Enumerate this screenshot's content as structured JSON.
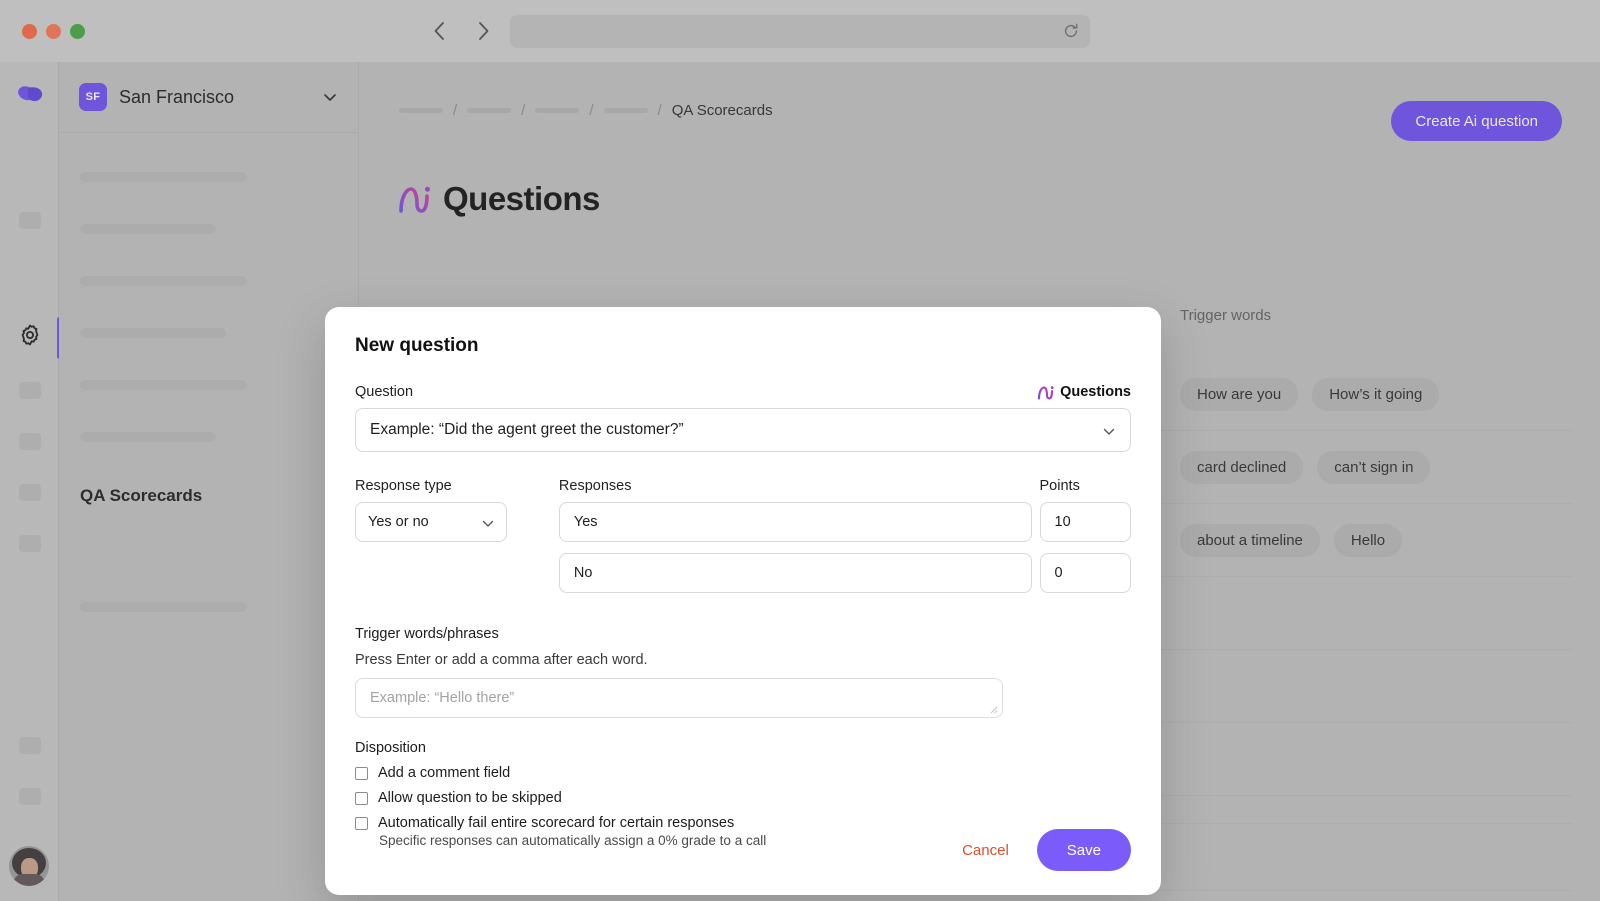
{
  "browser": {
    "traffic_lights": [
      "close",
      "minimize",
      "zoom"
    ],
    "back_label": "Back",
    "forward_label": "Forward",
    "url_value": "",
    "url_placeholder": "",
    "reload_label": "Reload"
  },
  "rail": {
    "logo_name": "app-logo",
    "active_item": "settings",
    "placeholder_count_top": 1,
    "placeholder_count_mid": 4,
    "placeholder_count_bottom": 2,
    "avatar_label": "User avatar"
  },
  "sidebar": {
    "org": {
      "initials": "SF",
      "name": "San Francisco",
      "chevron": "chevron-down-icon"
    },
    "section_title": "QA Scorecards"
  },
  "breadcrumb": {
    "placeholder_segments": 4,
    "separator": "/",
    "current": "QA Scorecards"
  },
  "header": {
    "create_button": "Create Ai question",
    "page_title": "Questions",
    "ai_mark": "ai-logo"
  },
  "panel": {
    "heading": "Trigger words",
    "rows": [
      {
        "chips": [
          "How are you",
          "How’s it going"
        ]
      },
      {
        "chips": [
          "card declined",
          "can’t sign in"
        ]
      },
      {
        "chips": [
          "about a timeline",
          "Hello"
        ]
      },
      {
        "chips": []
      },
      {
        "chips": []
      },
      {
        "chips": []
      }
    ]
  },
  "modal": {
    "title": "New question",
    "question": {
      "label": "Question",
      "badge": "Questions",
      "value": "Example: “Did the agent greet the customer?”"
    },
    "columns": {
      "response_type": "Response type",
      "responses": "Responses",
      "points": "Points"
    },
    "response_type_value": "Yes or no",
    "responses": [
      {
        "text": "Yes",
        "points": "10"
      },
      {
        "text": "No",
        "points": "0"
      }
    ],
    "trigger": {
      "title": "Trigger words/phrases",
      "help": "Press Enter or add a comma after each word.",
      "value": "",
      "placeholder": "Example: “Hello there”"
    },
    "disposition": {
      "title": "Disposition",
      "options": [
        {
          "label": "Add a comment field",
          "checked": false
        },
        {
          "label": "Allow question to be skipped",
          "checked": false
        },
        {
          "label": "Automatically fail entire scorecard for certain responses",
          "checked": false,
          "sub": "Specific responses can automatically assign a 0% grade to a call"
        }
      ]
    },
    "cancel_label": "Cancel",
    "save_label": "Save"
  },
  "colors": {
    "accent": "#6c4df2",
    "save": "#7b5cfa",
    "cancel": "#d94f2b",
    "ai_gradient_start": "#6c4df2",
    "ai_gradient_end": "#d9359b"
  }
}
